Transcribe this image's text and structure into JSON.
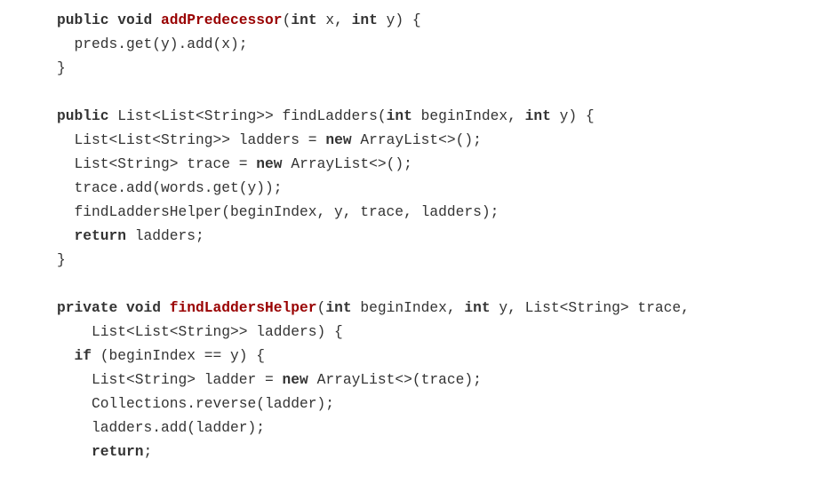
{
  "colors": {
    "text": "#333333",
    "keyword": "#333333",
    "function": "#990000"
  },
  "lines": [
    [
      {
        "c": "k",
        "s": "public void "
      },
      {
        "c": "f",
        "s": "addPredecessor"
      },
      {
        "c": "t",
        "s": "("
      },
      {
        "c": "k",
        "s": "int"
      },
      {
        "c": "t",
        "s": " x, "
      },
      {
        "c": "k",
        "s": "int"
      },
      {
        "c": "t",
        "s": " y) {"
      }
    ],
    [
      {
        "c": "t",
        "s": "  preds.get(y).add(x);"
      }
    ],
    [
      {
        "c": "t",
        "s": "}"
      }
    ],
    [],
    [
      {
        "c": "k",
        "s": "public"
      },
      {
        "c": "t",
        "s": " List<List<String>> findLadders("
      },
      {
        "c": "k",
        "s": "int"
      },
      {
        "c": "t",
        "s": " beginIndex, "
      },
      {
        "c": "k",
        "s": "int"
      },
      {
        "c": "t",
        "s": " y) {"
      }
    ],
    [
      {
        "c": "t",
        "s": "  List<List<String>> ladders = "
      },
      {
        "c": "k",
        "s": "new"
      },
      {
        "c": "t",
        "s": " ArrayList<>();"
      }
    ],
    [
      {
        "c": "t",
        "s": "  List<String> trace = "
      },
      {
        "c": "k",
        "s": "new"
      },
      {
        "c": "t",
        "s": " ArrayList<>();"
      }
    ],
    [
      {
        "c": "t",
        "s": "  trace.add(words.get(y));"
      }
    ],
    [
      {
        "c": "t",
        "s": "  findLaddersHelper(beginIndex, y, trace, ladders);"
      }
    ],
    [
      {
        "c": "t",
        "s": "  "
      },
      {
        "c": "k",
        "s": "return"
      },
      {
        "c": "t",
        "s": " ladders;"
      }
    ],
    [
      {
        "c": "t",
        "s": "}"
      }
    ],
    [],
    [
      {
        "c": "k",
        "s": "private void "
      },
      {
        "c": "f",
        "s": "findLaddersHelper"
      },
      {
        "c": "t",
        "s": "("
      },
      {
        "c": "k",
        "s": "int"
      },
      {
        "c": "t",
        "s": " beginIndex, "
      },
      {
        "c": "k",
        "s": "int"
      },
      {
        "c": "t",
        "s": " y, List<String> trace,"
      }
    ],
    [
      {
        "c": "t",
        "s": "    List<List<String>> ladders) {"
      }
    ],
    [
      {
        "c": "t",
        "s": "  "
      },
      {
        "c": "k",
        "s": "if"
      },
      {
        "c": "t",
        "s": " (beginIndex == y) {"
      }
    ],
    [
      {
        "c": "t",
        "s": "    List<String> ladder = "
      },
      {
        "c": "k",
        "s": "new"
      },
      {
        "c": "t",
        "s": " ArrayList<>(trace);"
      }
    ],
    [
      {
        "c": "t",
        "s": "    Collections.reverse(ladder);"
      }
    ],
    [
      {
        "c": "t",
        "s": "    ladders.add(ladder);"
      }
    ],
    [
      {
        "c": "t",
        "s": "    "
      },
      {
        "c": "k",
        "s": "return"
      },
      {
        "c": "t",
        "s": ";"
      }
    ]
  ]
}
